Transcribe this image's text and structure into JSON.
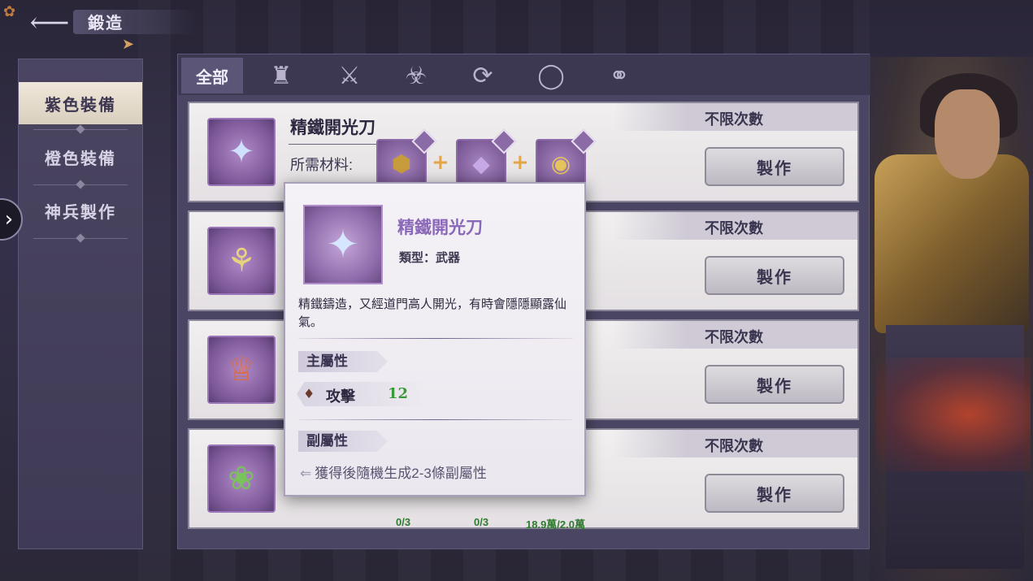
{
  "header": {
    "title": "鍛造"
  },
  "sidebar": {
    "items": [
      {
        "label": "紫色裝備",
        "active": true
      },
      {
        "label": "橙色裝備",
        "active": false
      },
      {
        "label": "神兵製作",
        "active": false
      }
    ]
  },
  "category_tabs": [
    {
      "label": "全部",
      "icon": "all",
      "active": true
    },
    {
      "icon": "helmet-icon"
    },
    {
      "icon": "sword-icon"
    },
    {
      "icon": "armor-icon"
    },
    {
      "icon": "belt-icon"
    },
    {
      "icon": "ring-icon"
    },
    {
      "icon": "necklace-icon"
    }
  ],
  "recipes": [
    {
      "name": "精鐵開光刀",
      "limit": "不限次數",
      "materials_label": "所需材料:",
      "craft_label": "製作",
      "icon": "sword-icon",
      "materials": [
        {
          "icon": "ore-icon",
          "count": ""
        },
        {
          "icon": "crystal-icon",
          "count": ""
        },
        {
          "icon": "coin-icon",
          "count": ""
        }
      ]
    },
    {
      "limit": "不限次數",
      "craft_label": "製作",
      "icon": "chest-armor-icon"
    },
    {
      "limit": "不限次數",
      "craft_label": "製作",
      "icon": "crown-icon"
    },
    {
      "limit": "不限次數",
      "craft_label": "製作",
      "icon": "jade-pendant-icon",
      "materials": [
        {
          "icon": "ore-icon",
          "count": "0/3"
        },
        {
          "icon": "crystal-icon",
          "count": "0/3"
        },
        {
          "icon": "coin-icon",
          "count": "18.9萬/2.0萬"
        }
      ]
    }
  ],
  "tooltip": {
    "name": "精鐵開光刀",
    "type": "類型：武器",
    "description": "精鐵鑄造，又經道門高人開光，有時會隱隱顯露仙氣。",
    "main_attr_title": "主屬性",
    "main_attr": {
      "label": "攻擊",
      "value": "12"
    },
    "sub_attr_title": "副屬性",
    "sub_attr_text": "獲得後隨機生成2-3條副屬性"
  },
  "colors": {
    "accent_purple": "#8a68b8",
    "stat_green": "#3a9a3a",
    "material_plus": "#e2a548"
  }
}
